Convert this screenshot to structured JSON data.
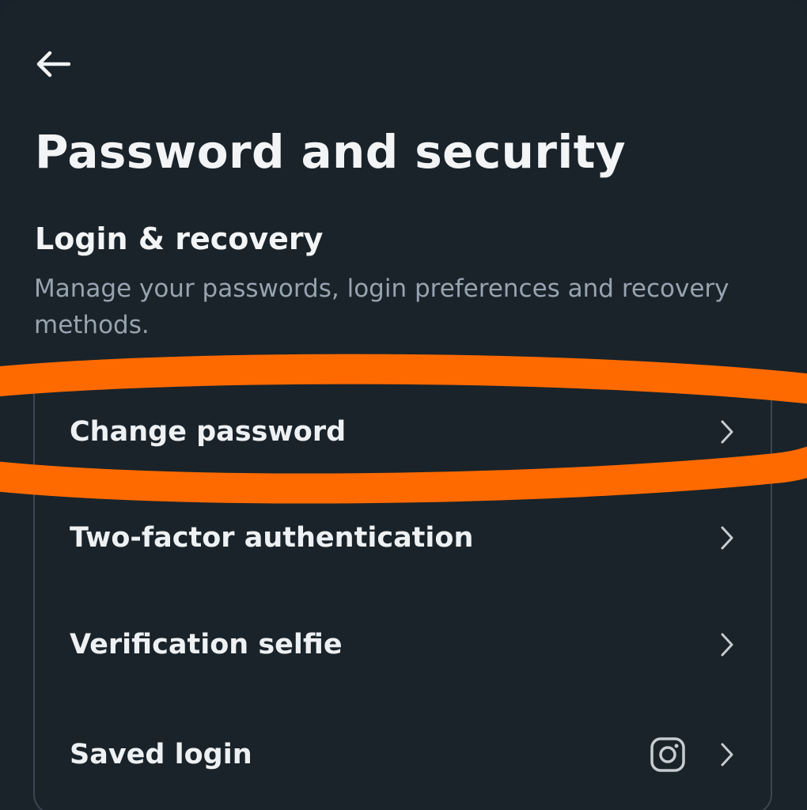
{
  "header": {
    "back_icon": "arrow-left-icon",
    "title": "Password and security"
  },
  "section": {
    "title": "Login & recovery",
    "description": "Manage your passwords, login preferences and recovery methods."
  },
  "menu": {
    "items": [
      {
        "label": "Change password",
        "icon": "chevron-right-icon"
      },
      {
        "label": "Two-factor authentication",
        "icon": "chevron-right-icon"
      },
      {
        "label": "Verification selfie",
        "icon": "chevron-right-icon"
      },
      {
        "label": "Saved login",
        "badge_icon": "instagram-icon",
        "icon": "chevron-right-icon"
      }
    ]
  },
  "annotation": {
    "shape": "ellipse-highlight",
    "target": "Change password",
    "color": "#ff6a00"
  },
  "colors": {
    "background": "#1a232a",
    "text_primary": "#f2f4f5",
    "text_secondary": "#97a3ae",
    "card_border": "#3b4650"
  }
}
